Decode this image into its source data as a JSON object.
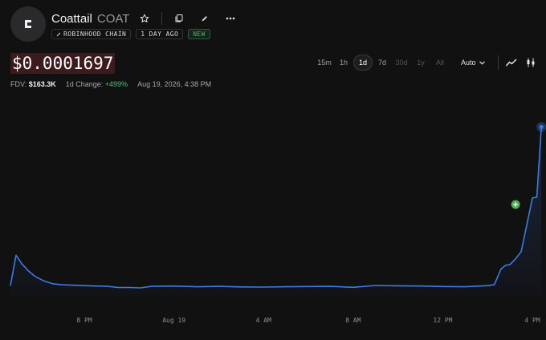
{
  "token": {
    "name": "Coattail",
    "ticker": "COAT",
    "tags": [
      "ROBINHOOD CHAIN",
      "1 DAY AGO"
    ],
    "new_badge": "NEW"
  },
  "price": "$0.0001697",
  "stats": {
    "fdv_label": "FDV:",
    "fdv_value": "$163.3K",
    "change_label": "1d Change:",
    "change_value": "+499%",
    "timestamp": "Aug 19, 2026, 4:38 PM"
  },
  "timeframes": [
    {
      "label": "15m",
      "state": "normal"
    },
    {
      "label": "1h",
      "state": "normal"
    },
    {
      "label": "1d",
      "state": "active"
    },
    {
      "label": "7d",
      "state": "normal"
    },
    {
      "label": "30d",
      "state": "disabled"
    },
    {
      "label": "1y",
      "state": "disabled"
    },
    {
      "label": "All",
      "state": "disabled"
    }
  ],
  "scale_mode": "Auto",
  "icons": [
    "star-icon",
    "copy-icon",
    "edit-icon",
    "more-icon",
    "chevron-down-icon",
    "line-chart-icon",
    "candlestick-icon"
  ],
  "colors": {
    "line": "#3b7ae8",
    "positive": "#4ec27a",
    "price_highlight": "#3d1a1d",
    "marker": "#4caf50"
  },
  "chart_data": {
    "type": "area",
    "x_tick_labels": [
      "8 PM",
      "Aug 19",
      "4 AM",
      "8 AM",
      "12 PM",
      "4 PM"
    ],
    "x_ticks": [
      20,
      24,
      28,
      32,
      36,
      40
    ],
    "x_range": [
      16.7,
      40.5
    ],
    "y_range": [
      0,
      1
    ],
    "grid": false,
    "series": [
      {
        "x": [
          16.7,
          16.95,
          17.2,
          17.5,
          17.8,
          18.2,
          18.6,
          19.0,
          19.5,
          20.0,
          20.5,
          21.0,
          21.5,
          22.0,
          22.5,
          23.0,
          24.0,
          25.0,
          26.0,
          27.0,
          28.0,
          29.0,
          30.0,
          31.0,
          32.0,
          33.0,
          34.0,
          35.0,
          36.0,
          37.0,
          38.0,
          38.3,
          38.6,
          38.8,
          39.0,
          39.25,
          39.5,
          39.75,
          40.0,
          40.2,
          40.4
        ],
        "y": [
          0.06,
          0.225,
          0.18,
          0.14,
          0.11,
          0.085,
          0.07,
          0.065,
          0.062,
          0.06,
          0.058,
          0.057,
          0.05,
          0.05,
          0.048,
          0.056,
          0.058,
          0.054,
          0.056,
          0.053,
          0.052,
          0.054,
          0.055,
          0.056,
          0.051,
          0.061,
          0.059,
          0.058,
          0.055,
          0.054,
          0.06,
          0.065,
          0.15,
          0.17,
          0.175,
          0.205,
          0.245,
          0.39,
          0.535,
          0.54,
          0.92
        ]
      }
    ],
    "marker": {
      "x": 39.25,
      "y": 0.5
    }
  }
}
